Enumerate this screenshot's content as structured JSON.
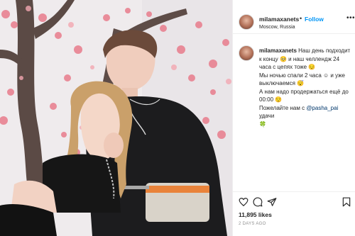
{
  "post": {
    "username": "milamaxanets",
    "follow_label": "Follow",
    "separator": "•",
    "location": "Moscow, Russia",
    "caption": {
      "username": "milamaxanets",
      "line1": "Наш день подходит к концу 🥺 и наш челлендж 24 часа с цепях тоже 😔",
      "line2": "Мы ночью спали 2 часа ☺ и уже выключаемся 😴",
      "line3": "А нам надо продержаться ещё до 00:00 😌",
      "line4_prefix": "Пожелайте нам с",
      "mention": "@pasha_pai",
      "line4_suffix": "удачи",
      "line5": "🍀"
    },
    "time_ago": "2d",
    "likes": "11,895 likes",
    "posted": "2 DAYS AGO"
  },
  "icons": {
    "more": "more-horizontal-icon",
    "like": "heart-icon",
    "comment": "comment-icon",
    "share": "paper-plane-icon",
    "save": "bookmark-icon"
  },
  "colors": {
    "link_blue": "#0095f6",
    "text": "#262626",
    "muted": "#8e8e8e",
    "mention": "#00376b",
    "divider": "#efefef"
  }
}
